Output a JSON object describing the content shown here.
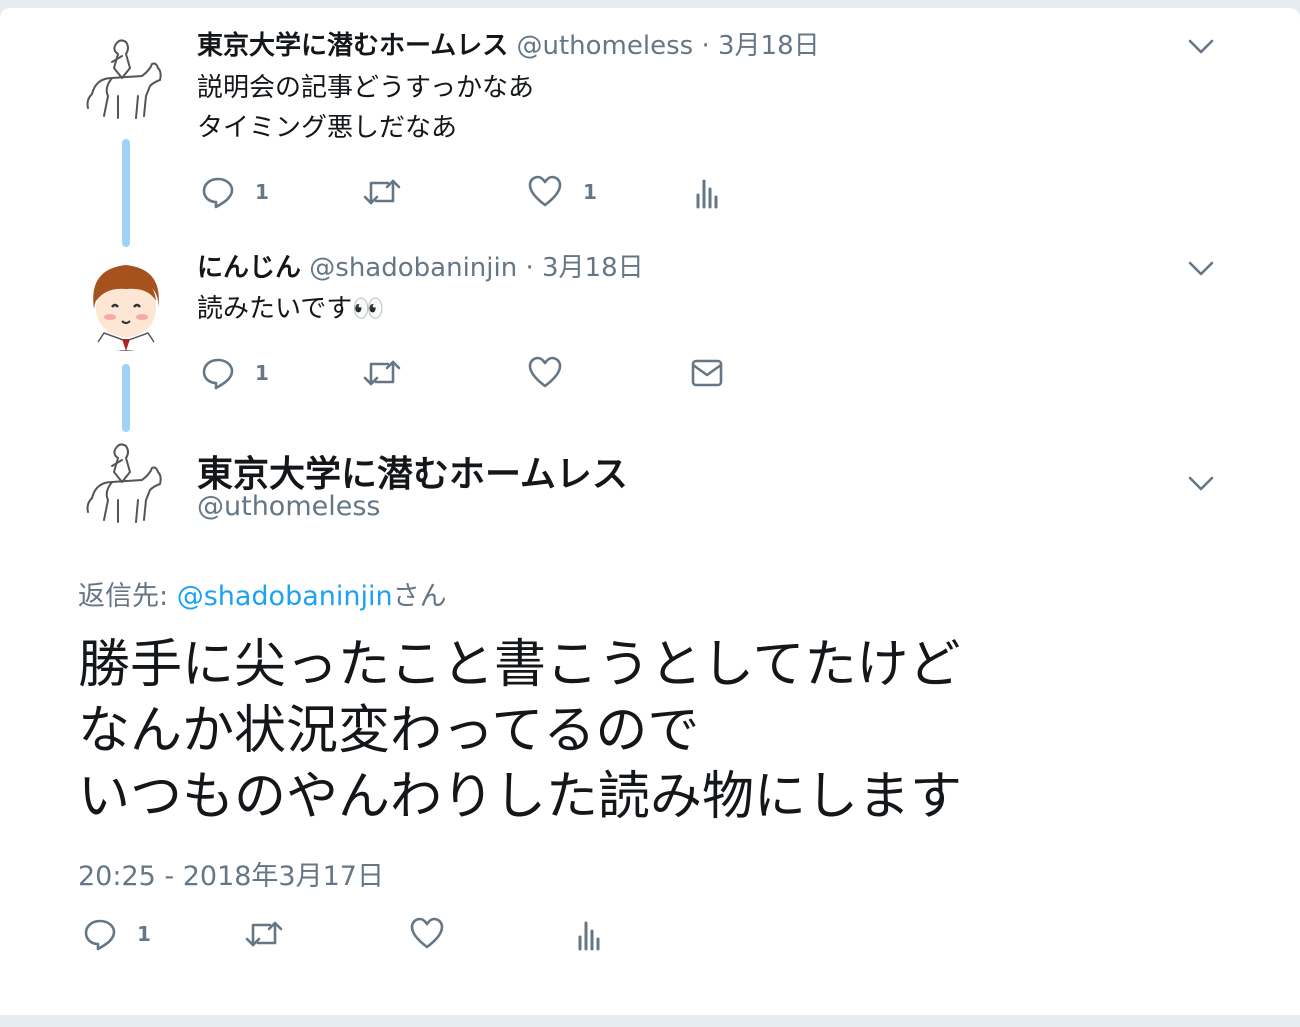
{
  "colors": {
    "accent": "#1da1f2",
    "thread_line": "#9fd2f5",
    "muted": "#657786",
    "text": "#14171a"
  },
  "thread": [
    {
      "avatar_icon": "horse-sketch-avatar-icon",
      "name": "東京大学に潜むホームレス",
      "handle": "@uthomeless",
      "separator": "·",
      "date": "3月18日",
      "lines": [
        "説明会の記事どうすっかなあ",
        "タイミング悪しだなあ"
      ],
      "reply_count": "1",
      "retweet_count": "",
      "like_count": "1",
      "extra_icon": "analytics-icon"
    },
    {
      "avatar_icon": "girl-character-avatar-icon",
      "name": "にんじん",
      "handle": "@shadobaninjin",
      "separator": "·",
      "date": "3月18日",
      "lines": [
        "読みたいです👀"
      ],
      "reply_count": "1",
      "retweet_count": "",
      "like_count": "",
      "extra_icon": "direct-message-icon"
    }
  ],
  "main_tweet": {
    "avatar_icon": "horse-sketch-avatar-icon",
    "name": "東京大学に潜むホームレス",
    "handle": "@uthomeless",
    "reply_prefix": "返信先: ",
    "reply_handle": "@shadobaninjin",
    "reply_suffix": "さん",
    "lines": [
      "勝手に尖ったこと書こうとしてたけど",
      "なんか状況変わってるので",
      "いつものやんわりした読み物にします"
    ],
    "timestamp": "20:25 - 2018年3月17日",
    "reply_count": "1",
    "extra_icon": "analytics-icon"
  }
}
